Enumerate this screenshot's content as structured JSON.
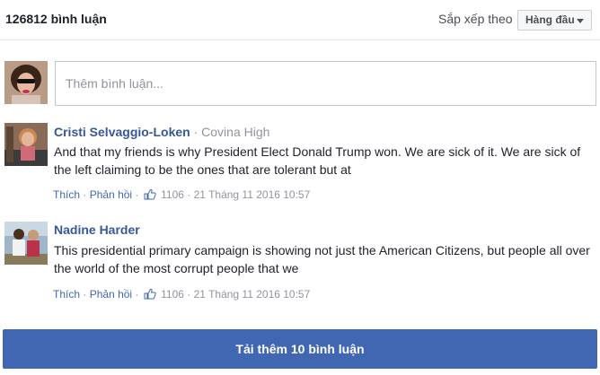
{
  "header": {
    "comment_count": "126812 bình luận",
    "sort_label": "Sắp xếp theo",
    "sort_value": "Hàng đầu"
  },
  "composer": {
    "placeholder": "Thêm bình luận..."
  },
  "comments": [
    {
      "author": "Cristi Selvaggio-Loken",
      "separator": " · ",
      "affiliation": "Covina High",
      "text": "And that my friends is why President Elect Donald Trump won. We are sick of it. We are sick of the left claiming to be the ones that are tolerant but at",
      "like_label": "Thích",
      "reply_label": "Phản hồi",
      "like_count": "1106",
      "timestamp": "21 Tháng 11 2016 10:57"
    },
    {
      "author": "Nadine Harder",
      "text": "This presidential primary campaign is showing not just the American Citizens, but people all over the world of the most corrupt people that we",
      "like_label": "Thích",
      "reply_label": "Phản hồi",
      "like_count": "1106",
      "timestamp": "21 Tháng 11 2016 10:57"
    }
  ],
  "load_more_label": "Tải thêm 10 bình luận",
  "colors": {
    "link": "#365899",
    "action_link": "#4267b2",
    "button": "#4267b2",
    "meta": "#90949c"
  },
  "icons": [
    "caret-down-icon",
    "thumbs-up-icon"
  ]
}
